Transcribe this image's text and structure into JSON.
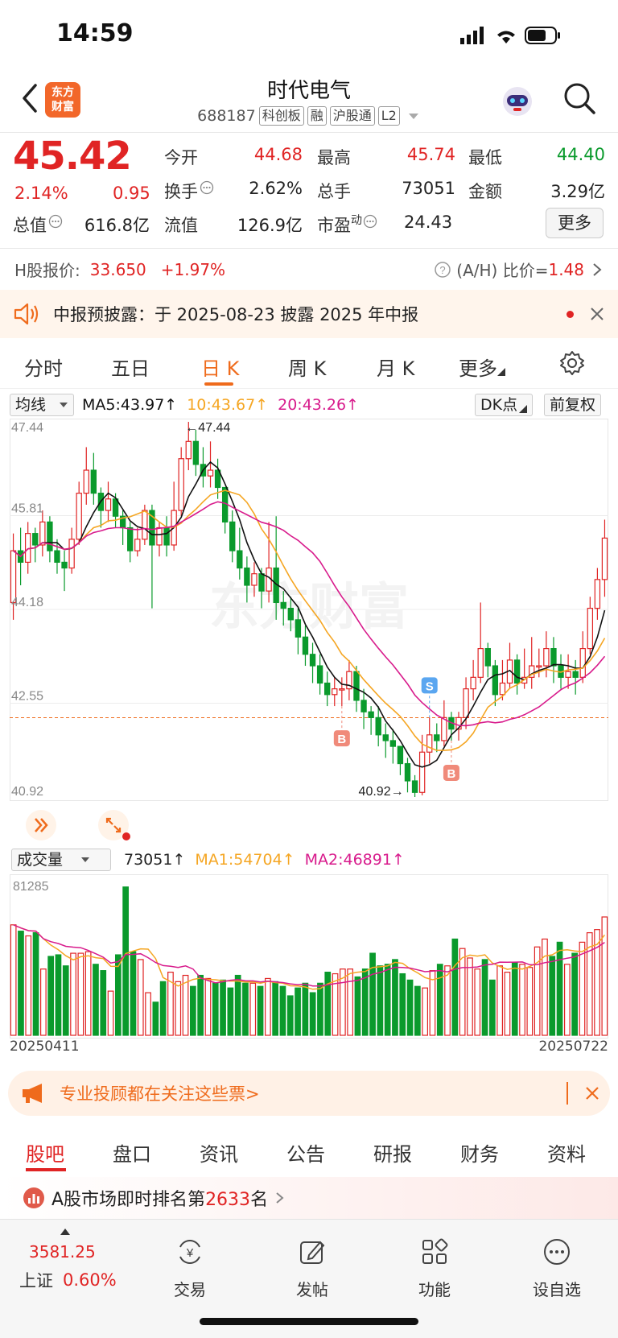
{
  "status": {
    "time": "14:59"
  },
  "header": {
    "brand_line1": "东方",
    "brand_line2": "财富",
    "name": "时代电气",
    "code": "688187",
    "tags": [
      "科创板",
      "融",
      "沪股通",
      "L2"
    ]
  },
  "quote": {
    "price": "45.42",
    "change_pct": "2.14%",
    "change_amt": "0.95",
    "fields": {
      "open_label": "今开",
      "open": "44.68",
      "high_label": "最高",
      "high": "45.74",
      "low_label": "最低",
      "low": "44.40",
      "turnover_label": "换手",
      "turnover": "2.62%",
      "volume_label": "总手",
      "volume": "73051",
      "amount_label": "金额",
      "amount": "3.29亿",
      "mktcap_label": "总值",
      "mktcap": "616.8亿",
      "float_label": "流值",
      "float": "126.9亿",
      "pe_label": "市盈",
      "pe_sup": "动",
      "pe": "24.43"
    },
    "more_label": "更多"
  },
  "hshare": {
    "label": "H股报价:",
    "price": "33.650",
    "change": "+1.97%",
    "ratio_label": "(A/H) 比价=",
    "ratio": "1.48"
  },
  "notice": {
    "text": "中报预披露：于 2025-08-23 披露 2025 年中报"
  },
  "period_tabs": [
    "分时",
    "五日",
    "日 K",
    "周 K",
    "月 K",
    "更多"
  ],
  "ma_row": {
    "selector": "均线",
    "ma5": "MA5:43.97↑",
    "ma10": "10:43.67↑",
    "ma20": "20:43.26↑",
    "dk_label": "DK点",
    "adjust_label": "前复权"
  },
  "kchart_axis": {
    "y_labels": [
      "47.44",
      "45.81",
      "44.18",
      "42.55",
      "40.92"
    ],
    "high_mark": "47.44",
    "low_mark": "40.92",
    "watermark": "东方财富",
    "signal_buy": "B",
    "signal_sell": "S"
  },
  "vol_row": {
    "selector": "成交量",
    "vol": "73051↑",
    "ma1": "MA1:54704↑",
    "ma2": "MA2:46891↑",
    "max_label": "81285"
  },
  "dates": {
    "start": "20250411",
    "end": "20250722"
  },
  "colors": {
    "up": "#e02424",
    "down": "#0a9a2c",
    "ma5": "#111111",
    "ma10": "#f5a623",
    "ma20": "#d81b8c",
    "accent": "#ef6b1c"
  },
  "chart_data": {
    "type": "candlestick",
    "y_range": [
      40.92,
      47.44
    ],
    "candles": [
      [
        44.3,
        45.2,
        44.0,
        45.5
      ],
      [
        45.2,
        45.0,
        44.6,
        45.6
      ],
      [
        45.0,
        45.5,
        44.8,
        45.7
      ],
      [
        45.5,
        45.3,
        45.0,
        45.6
      ],
      [
        45.3,
        45.7,
        45.1,
        45.9
      ],
      [
        45.7,
        45.2,
        45.0,
        45.8
      ],
      [
        45.2,
        45.0,
        44.8,
        45.4
      ],
      [
        45.0,
        44.9,
        44.5,
        45.2
      ],
      [
        44.9,
        45.4,
        44.8,
        45.6
      ],
      [
        45.4,
        46.2,
        45.3,
        46.4
      ],
      [
        46.2,
        46.6,
        46.0,
        47.0
      ],
      [
        46.6,
        46.2,
        46.0,
        46.9
      ],
      [
        46.2,
        45.9,
        45.6,
        46.3
      ],
      [
        45.9,
        46.1,
        45.7,
        46.4
      ],
      [
        46.1,
        45.8,
        45.6,
        46.2
      ],
      [
        45.8,
        45.6,
        45.3,
        45.9
      ],
      [
        45.6,
        45.2,
        45.0,
        45.7
      ],
      [
        45.2,
        45.4,
        45.1,
        45.6
      ],
      [
        45.4,
        45.9,
        45.3,
        46.0
      ],
      [
        45.9,
        45.3,
        44.2,
        46.0
      ],
      [
        45.3,
        45.6,
        45.1,
        45.7
      ],
      [
        45.6,
        45.3,
        45.1,
        45.8
      ],
      [
        45.3,
        45.9,
        45.2,
        46.4
      ],
      [
        45.9,
        46.8,
        45.8,
        47.0
      ],
      [
        46.8,
        47.1,
        46.6,
        47.44
      ],
      [
        47.1,
        46.7,
        46.5,
        47.3
      ],
      [
        46.7,
        46.5,
        46.3,
        47.0
      ],
      [
        46.5,
        46.6,
        46.3,
        47.1
      ],
      [
        46.6,
        46.3,
        46.1,
        46.8
      ],
      [
        46.3,
        45.7,
        45.5,
        46.3
      ],
      [
        45.7,
        45.2,
        45.0,
        45.9
      ],
      [
        45.2,
        44.9,
        44.7,
        45.6
      ],
      [
        44.9,
        44.6,
        44.3,
        45.1
      ],
      [
        44.6,
        44.8,
        44.4,
        45.0
      ],
      [
        44.8,
        44.5,
        44.2,
        44.9
      ],
      [
        44.5,
        44.9,
        44.3,
        45.7
      ],
      [
        44.9,
        44.3,
        44.0,
        45.8
      ],
      [
        44.3,
        44.2,
        43.9,
        44.5
      ],
      [
        44.2,
        44.0,
        43.8,
        44.4
      ],
      [
        44.0,
        43.7,
        43.4,
        44.2
      ],
      [
        43.7,
        43.4,
        43.2,
        43.9
      ],
      [
        43.4,
        43.2,
        42.9,
        43.6
      ],
      [
        43.2,
        42.9,
        42.7,
        43.4
      ],
      [
        42.9,
        42.7,
        42.5,
        43.1
      ],
      [
        42.7,
        42.8,
        42.5,
        43.0
      ],
      [
        42.8,
        42.8,
        42.5,
        43.0
      ],
      [
        42.8,
        43.1,
        42.6,
        43.3
      ],
      [
        43.1,
        42.6,
        42.4,
        43.2
      ],
      [
        42.6,
        42.4,
        42.1,
        42.8
      ],
      [
        42.4,
        42.3,
        42.0,
        42.5
      ],
      [
        42.3,
        42.0,
        41.8,
        42.5
      ],
      [
        42.0,
        41.9,
        41.6,
        42.2
      ],
      [
        41.9,
        41.8,
        41.5,
        42.1
      ],
      [
        41.8,
        41.5,
        41.3,
        41.8
      ],
      [
        41.5,
        41.2,
        41.0,
        41.6
      ],
      [
        41.2,
        41.0,
        40.92,
        41.3
      ],
      [
        41.0,
        41.7,
        40.95,
        42.0
      ],
      [
        41.7,
        42.0,
        41.5,
        42.3
      ],
      [
        42.0,
        41.9,
        41.7,
        42.2
      ],
      [
        41.9,
        42.3,
        41.8,
        42.6
      ],
      [
        42.3,
        42.1,
        41.9,
        42.4
      ],
      [
        42.1,
        42.3,
        41.9,
        42.4
      ],
      [
        42.3,
        42.8,
        42.1,
        43.0
      ],
      [
        42.8,
        43.0,
        42.6,
        43.3
      ],
      [
        43.0,
        43.5,
        42.9,
        44.3
      ],
      [
        43.5,
        43.2,
        43.0,
        43.6
      ],
      [
        43.2,
        42.7,
        42.5,
        43.3
      ],
      [
        42.7,
        42.9,
        42.6,
        43.3
      ],
      [
        42.9,
        43.3,
        42.8,
        43.6
      ],
      [
        43.3,
        42.9,
        42.7,
        43.4
      ],
      [
        42.9,
        43.0,
        42.8,
        43.5
      ],
      [
        43.0,
        43.2,
        42.8,
        43.7
      ],
      [
        43.2,
        43.2,
        43.0,
        43.5
      ],
      [
        43.2,
        43.5,
        43.0,
        43.8
      ],
      [
        43.5,
        43.2,
        42.9,
        43.7
      ],
      [
        43.2,
        43.0,
        42.8,
        43.4
      ],
      [
        43.0,
        43.1,
        42.8,
        43.4
      ],
      [
        43.1,
        43.0,
        42.7,
        43.3
      ],
      [
        43.0,
        43.5,
        42.9,
        43.8
      ],
      [
        43.5,
        44.2,
        43.4,
        44.4
      ],
      [
        44.2,
        44.7,
        44.0,
        44.9
      ],
      [
        44.7,
        45.42,
        44.4,
        45.74
      ]
    ],
    "volumes": [
      0.7,
      0.66,
      0.63,
      0.65,
      0.42,
      0.5,
      0.51,
      0.44,
      0.52,
      0.52,
      0.53,
      0.45,
      0.41,
      0.28,
      0.51,
      0.94,
      0.53,
      0.48,
      0.27,
      0.21,
      0.34,
      0.4,
      0.34,
      0.38,
      0.31,
      0.38,
      0.36,
      0.33,
      0.35,
      0.3,
      0.38,
      0.33,
      0.33,
      0.31,
      0.36,
      0.34,
      0.31,
      0.25,
      0.3,
      0.33,
      0.27,
      0.33,
      0.4,
      0.39,
      0.42,
      0.42,
      0.37,
      0.42,
      0.52,
      0.44,
      0.45,
      0.48,
      0.39,
      0.35,
      0.31,
      0.3,
      0.41,
      0.45,
      0.44,
      0.61,
      0.55,
      0.49,
      0.42,
      0.48,
      0.35,
      0.44,
      0.4,
      0.46,
      0.45,
      0.43,
      0.56,
      0.61,
      0.5,
      0.59,
      0.45,
      0.52,
      0.59,
      0.65,
      0.67,
      0.75
    ]
  }
}
